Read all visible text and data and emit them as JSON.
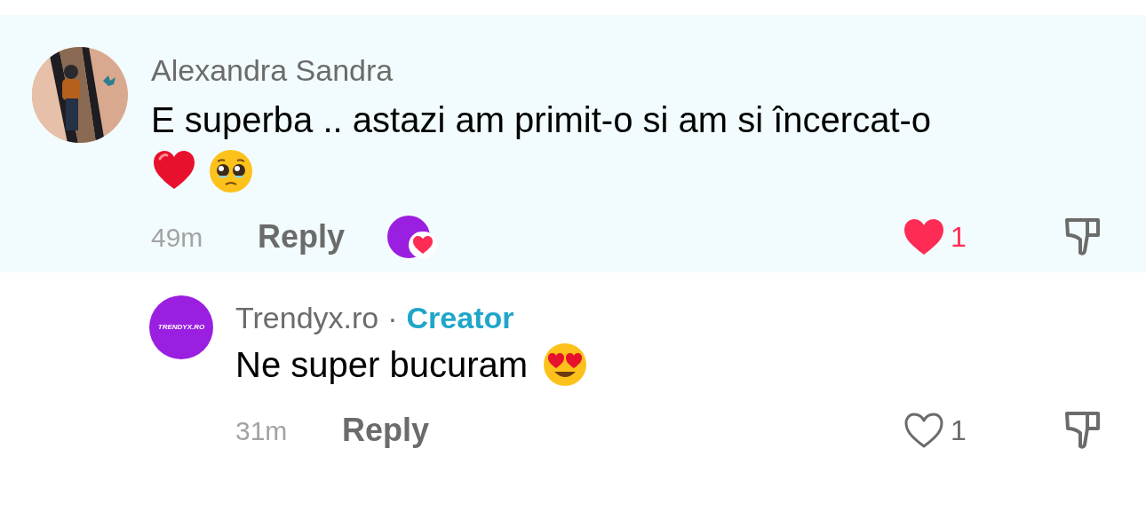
{
  "comments": [
    {
      "author": "Alexandra Sandra",
      "highlighted": true,
      "text": "E superba .. astazi am primit-o si am si încercat-o",
      "emojis": [
        {
          "kind": "red-heart"
        },
        {
          "kind": "teary-face"
        }
      ],
      "time": "49m",
      "reply": "Reply",
      "creator_liked": true,
      "likes": "1",
      "liked": true,
      "replies": [
        {
          "author": "Trendyx.ro",
          "separator": "·",
          "badge": "Creator",
          "avatar_text": "TRENDYX.RO",
          "text": "Ne super bucuram",
          "emojis": [
            {
              "kind": "heart-eyes"
            }
          ],
          "time": "31m",
          "reply": "Reply",
          "likes": "1",
          "liked": false
        }
      ]
    }
  ]
}
